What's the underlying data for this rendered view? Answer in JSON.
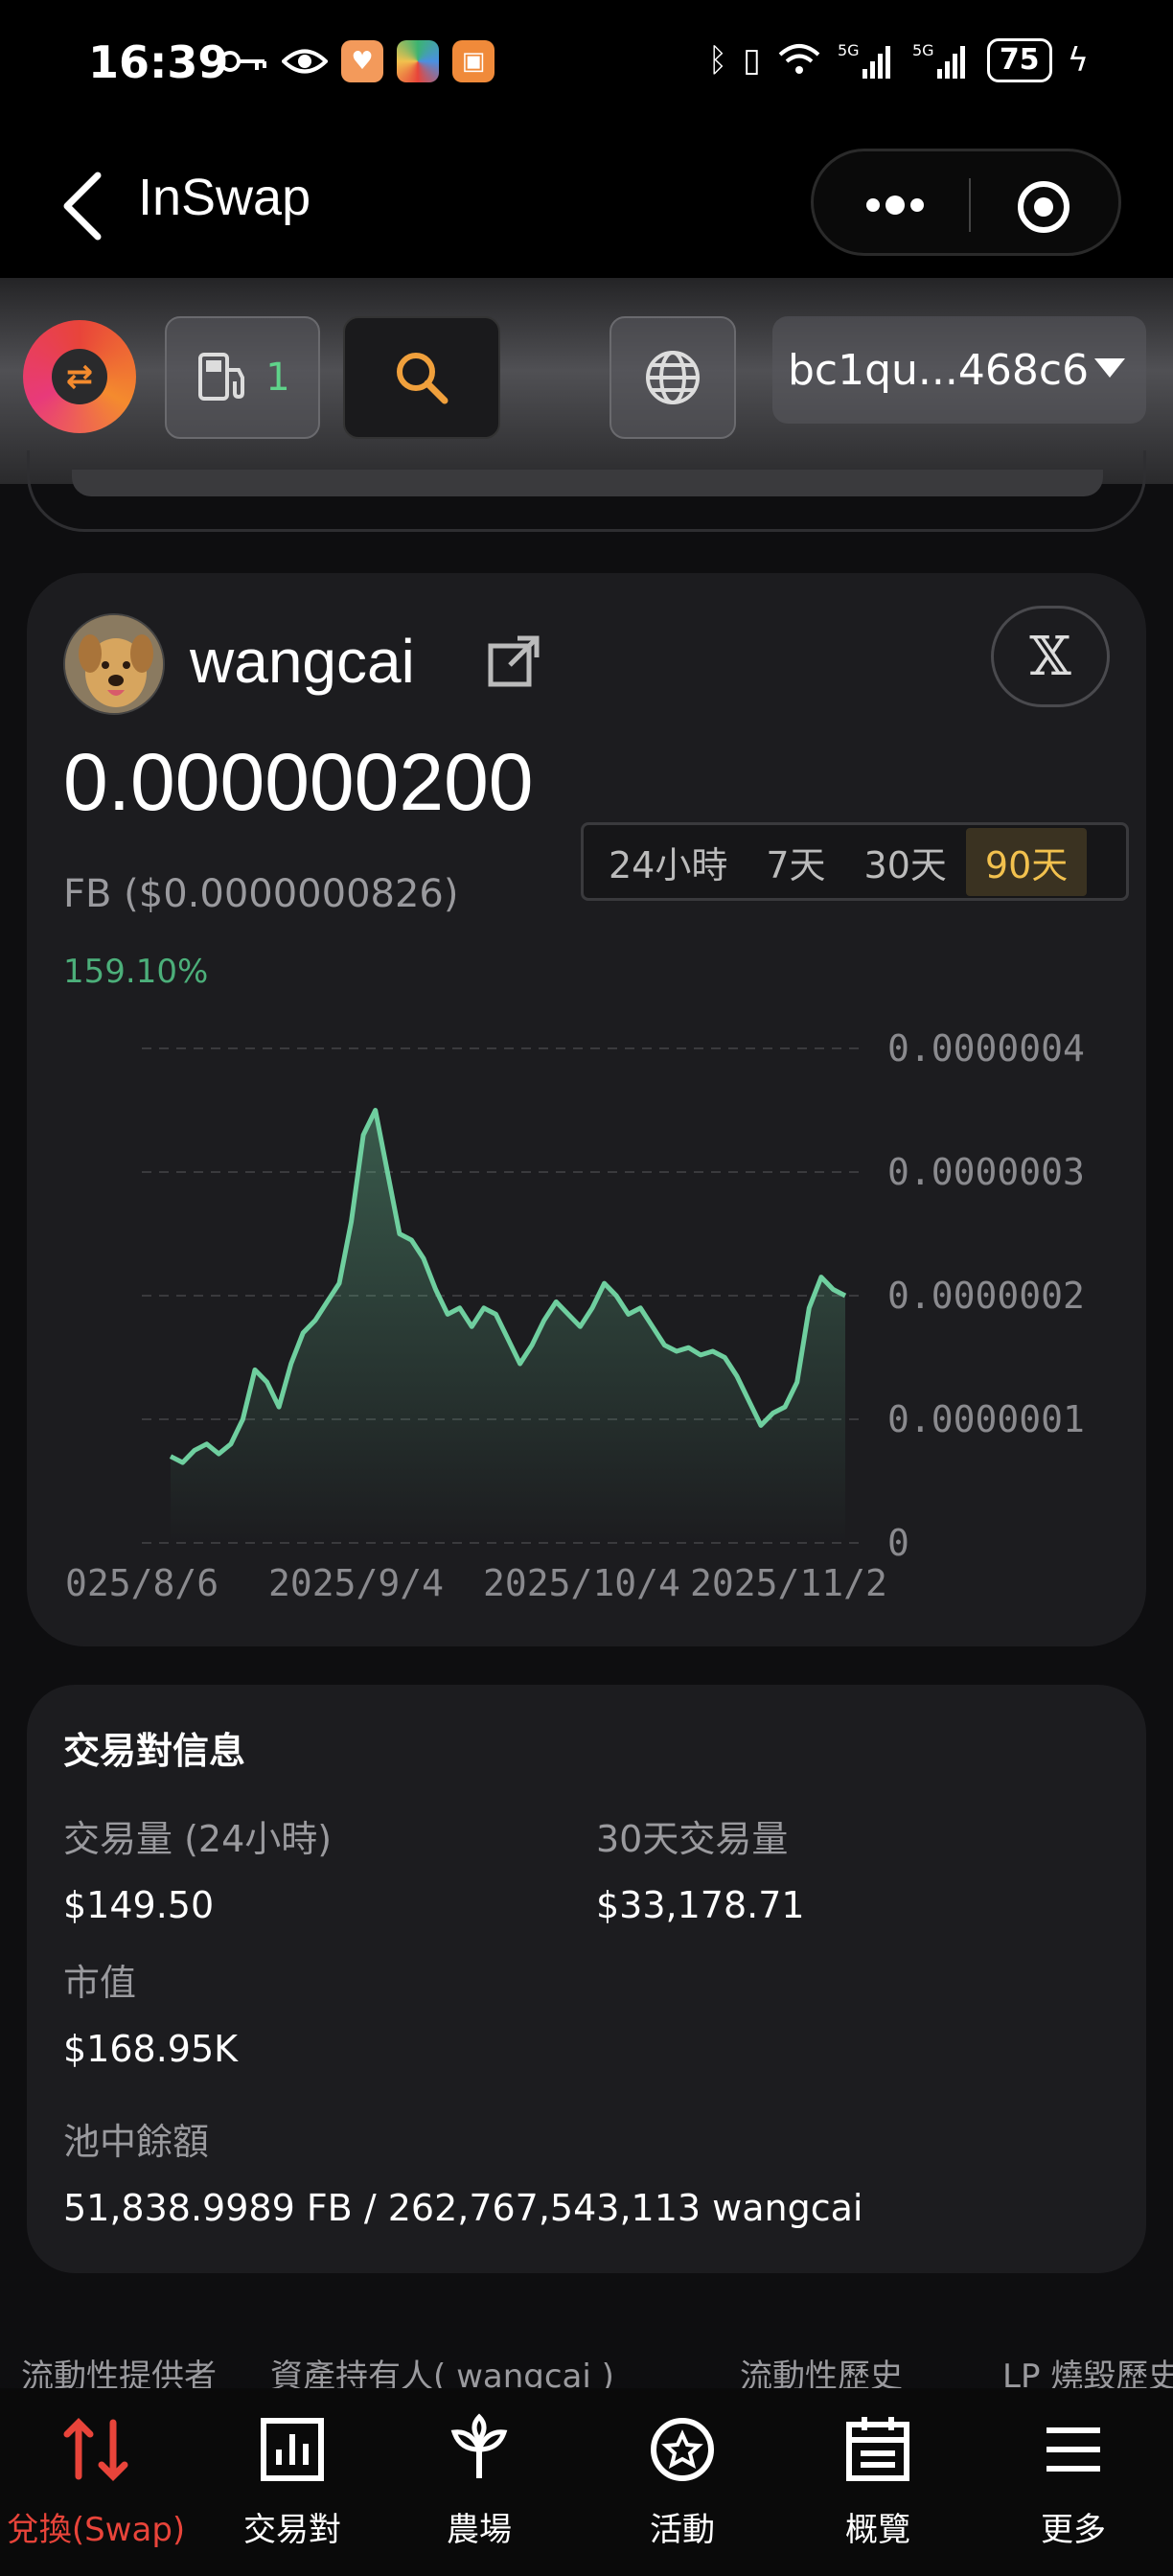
{
  "status_bar": {
    "time": "16:39",
    "battery": "75",
    "icons": [
      "key-icon",
      "eye-icon",
      "app-icon",
      "bluetooth-icon",
      "vibrate-icon",
      "wifi-icon",
      "5g-signal-icon",
      "5g-signal-icon",
      "charging-icon"
    ]
  },
  "titlebar": {
    "title": "InSwap"
  },
  "header": {
    "gas_count": "1",
    "wallet_address": "bc1qu...468c6"
  },
  "token": {
    "name": "wangcai",
    "price": "0.000000200",
    "unit_price": "FB ($0.0000000826)",
    "change": "159.10%",
    "range_tabs": [
      {
        "label": "24小時",
        "active": false
      },
      {
        "label": "7天",
        "active": false
      },
      {
        "label": "30天",
        "active": false
      },
      {
        "label": "90天",
        "active": true
      }
    ]
  },
  "chart_data": {
    "type": "area",
    "y_ticks": [
      "0.0000004",
      "0.0000003",
      "0.0000002",
      "0.0000001",
      "0"
    ],
    "x_ticks": [
      "025/8/6",
      "2025/9/4",
      "2025/10/4",
      "2025/11/2"
    ],
    "ylim": [
      0,
      4e-07
    ],
    "grid": true,
    "color": "#6fcf9f",
    "values": [
      7e-08,
      6.5e-08,
      7.5e-08,
      8e-08,
      7.2e-08,
      8e-08,
      1e-07,
      1.4e-07,
      1.3e-07,
      1.1e-07,
      1.45e-07,
      1.7e-07,
      1.8e-07,
      1.95e-07,
      2.1e-07,
      2.6e-07,
      3.3e-07,
      3.5e-07,
      3e-07,
      2.5e-07,
      2.45e-07,
      2.3e-07,
      2.05e-07,
      1.85e-07,
      1.9e-07,
      1.75e-07,
      1.9e-07,
      1.85e-07,
      1.65e-07,
      1.45e-07,
      1.6e-07,
      1.8e-07,
      1.95e-07,
      1.85e-07,
      1.75e-07,
      1.9e-07,
      2.1e-07,
      2e-07,
      1.85e-07,
      1.9e-07,
      1.75e-07,
      1.6e-07,
      1.55e-07,
      1.58e-07,
      1.52e-07,
      1.55e-07,
      1.5e-07,
      1.35e-07,
      1.15e-07,
      9.5e-08,
      1.05e-07,
      1.1e-07,
      1.3e-07,
      1.9e-07,
      2.15e-07,
      2.05e-07,
      2e-07
    ]
  },
  "pair_info": {
    "title": "交易對信息",
    "volume_24h_label": "交易量 (24小時)",
    "volume_24h_value": "$149.50",
    "volume_30d_label": "30天交易量",
    "volume_30d_value": "$33,178.71",
    "market_cap_label": "市值",
    "market_cap_value": "$168.95K",
    "pool_balance_label": "池中餘額",
    "pool_balance_value": "51,838.9989 FB / 262,767,543,113 wangcai"
  },
  "sub_tabs": [
    "流動性提供者",
    "資產持有人( wangcai )",
    "流動性歷史",
    "LP 燒毀歷史"
  ],
  "bottom_nav": [
    {
      "label": "兌換(Swap)",
      "icon": "swap-icon",
      "active": true
    },
    {
      "label": "交易對",
      "icon": "chart-icon",
      "active": false
    },
    {
      "label": "農場",
      "icon": "sprout-icon",
      "active": false
    },
    {
      "label": "活動",
      "icon": "star-badge-icon",
      "active": false
    },
    {
      "label": "概覽",
      "icon": "calendar-icon",
      "active": false
    },
    {
      "label": "更多",
      "icon": "menu-icon",
      "active": false
    }
  ]
}
